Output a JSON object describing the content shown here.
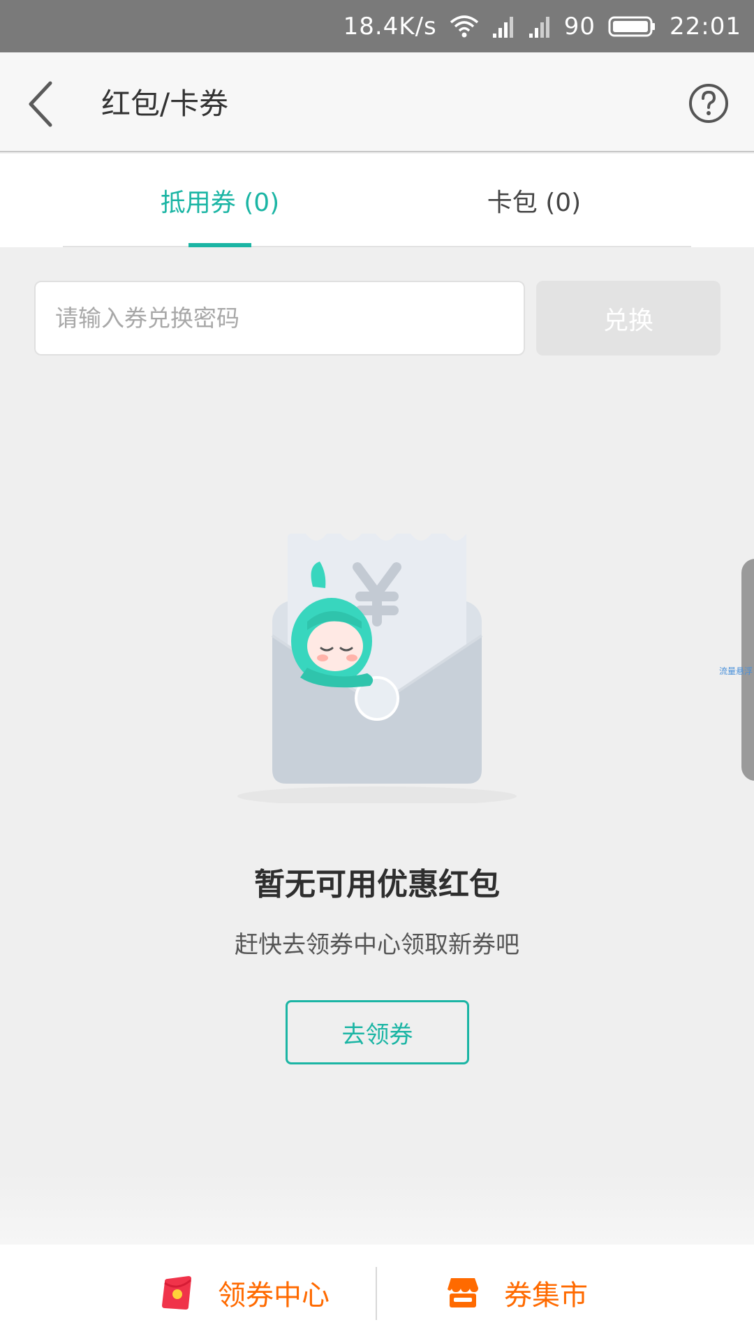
{
  "status_bar": {
    "net_speed": "18.4K/s",
    "battery": "90",
    "time": "22:01",
    "icons": [
      "wifi-icon",
      "signal-icon",
      "signal-icon",
      "battery-icon"
    ]
  },
  "header": {
    "title": "红包/卡券",
    "back_icon": "chevron-left-icon",
    "help_icon": "help-circle-icon"
  },
  "tabs": [
    {
      "label": "抵用券 (0)",
      "active": true
    },
    {
      "label": "卡包 (0)",
      "active": false
    }
  ],
  "redeem": {
    "placeholder": "请输入券兑换密码",
    "button_label": "兑换"
  },
  "empty_state": {
    "title": "暂无可用优惠红包",
    "subtitle": "赶快去领券中心领取新券吧",
    "button_label": "去领券",
    "illustration_icon": "empty-envelope-icon"
  },
  "side_panel": {
    "text": "流量悬浮"
  },
  "bottom_bar": {
    "items": [
      {
        "label": "领券中心",
        "icon": "red-packet-icon"
      },
      {
        "label": "券集市",
        "icon": "store-icon"
      }
    ]
  },
  "colors": {
    "accent": "#1bb5a4",
    "orange": "#ff6a00",
    "status_bar_bg": "#7a7a7a",
    "page_bg": "#efefef"
  }
}
